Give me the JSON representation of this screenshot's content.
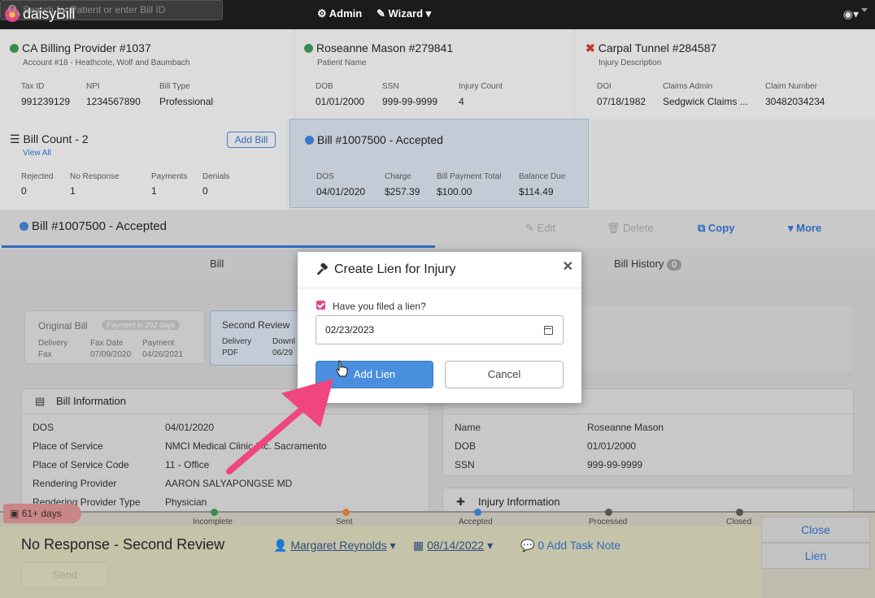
{
  "topbar": {
    "brand": "daisyBill",
    "search_placeholder": "Search for Patient or enter Bill ID",
    "admin_label": "Admin",
    "wizard_label": "Wizard"
  },
  "provider": {
    "title": "CA Billing Provider #1037",
    "subtitle": "Account #18 - Heathcote, Wolf and Baumbach",
    "fields": [
      {
        "label": "Tax ID",
        "value": "991239129"
      },
      {
        "label": "NPI",
        "value": "1234567890"
      },
      {
        "label": "Bill Type",
        "value": "Professional"
      }
    ]
  },
  "patient": {
    "title": "Roseanne Mason #279841",
    "subtitle": "Patient Name",
    "fields": [
      {
        "label": "DOB",
        "value": "01/01/2000"
      },
      {
        "label": "SSN",
        "value": "999-99-9999"
      },
      {
        "label": "Injury Count",
        "value": "4"
      }
    ]
  },
  "injury": {
    "title": "Carpal Tunnel #284587",
    "subtitle": "Injury Description",
    "fields": [
      {
        "label": "DOI",
        "value": "07/18/1982"
      },
      {
        "label": "Claims Admin",
        "value": "Sedgwick Claims ..."
      },
      {
        "label": "Claim Number",
        "value": "30482034234"
      }
    ]
  },
  "bill_count": {
    "title": "Bill Count - 2",
    "view_all": "View All",
    "add_bill": "Add Bill",
    "fields": [
      {
        "label": "Rejected",
        "value": "0"
      },
      {
        "label": "No Response",
        "value": "1"
      },
      {
        "label": "Payments",
        "value": "1"
      },
      {
        "label": "Denials",
        "value": "0"
      }
    ]
  },
  "bill_card": {
    "title": "Bill #1007500 - Accepted",
    "fields": [
      {
        "label": "DOS",
        "value": "04/01/2020"
      },
      {
        "label": "Charge",
        "value": "$257.39"
      },
      {
        "label": "Bill Payment Total",
        "value": "$100.00"
      },
      {
        "label": "Balance Due",
        "value": "$114.49"
      }
    ]
  },
  "page": {
    "title": "Bill #1007500 - Accepted",
    "actions": {
      "edit": "Edit",
      "delete": "Delete",
      "copy": "Copy",
      "more": "More"
    },
    "tabs": {
      "bill": "Bill",
      "history": "Bill History",
      "history_count": "0"
    }
  },
  "submissions": {
    "original": {
      "title": "Original Bill",
      "badge": "Payment in 292 days",
      "labels": [
        "Delivery",
        "Fax Date",
        "Payment"
      ],
      "values": [
        "Fax",
        "07/09/2020",
        "04/26/2021"
      ]
    },
    "second": {
      "title": "Second Review",
      "labels": [
        "Delivery",
        "Downl"
      ],
      "values": [
        "PDF",
        "06/29"
      ]
    }
  },
  "bill_info": {
    "title": "Bill Information",
    "rows": [
      {
        "label": "DOS",
        "value": "04/01/2020"
      },
      {
        "label": "Place of Service",
        "value": "NMCI Medical Clinic Inc. Sacramento"
      },
      {
        "label": "Place of Service Code",
        "value": "11 - Office"
      },
      {
        "label": "Rendering Provider",
        "value": "AARON SALYAPONGSE MD"
      },
      {
        "label": "Rendering Provider Type",
        "value": "Physician"
      }
    ]
  },
  "patient_info": {
    "rows": [
      {
        "label": "Name",
        "value": "Roseanne Mason"
      },
      {
        "label": "DOB",
        "value": "01/01/2000"
      },
      {
        "label": "SSN",
        "value": "999-99-9999"
      }
    ]
  },
  "injury_info": {
    "title": "Injury Information"
  },
  "footer": {
    "days_badge": "61+ days",
    "timeline": [
      "Incomplete",
      "Sent",
      "Accepted",
      "Processed",
      "Closed"
    ],
    "status": "No Response - Second Review",
    "assignee": "Margaret Reynolds",
    "date": "08/14/2022",
    "task_note": "0 Add Task Note",
    "send": "Send",
    "close": "Close",
    "lien": "Lien"
  },
  "modal": {
    "title": "Create Lien for Injury",
    "checkbox_label": "Have you filed a lien?",
    "date_value": "02/23/2023",
    "add_button": "Add Lien",
    "cancel_button": "Cancel"
  },
  "colors": {
    "accent": "#4a8fde",
    "pink": "#e2478b",
    "topbar": "#1b1b1b"
  }
}
